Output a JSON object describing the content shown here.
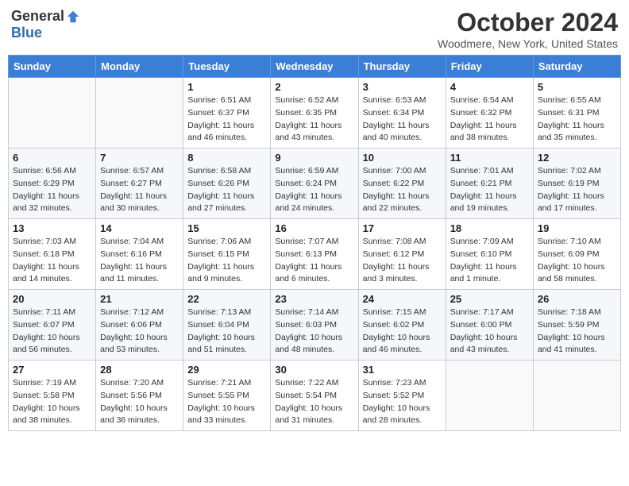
{
  "header": {
    "logo_general": "General",
    "logo_blue": "Blue",
    "month_title": "October 2024",
    "location": "Woodmere, New York, United States"
  },
  "days_of_week": [
    "Sunday",
    "Monday",
    "Tuesday",
    "Wednesday",
    "Thursday",
    "Friday",
    "Saturday"
  ],
  "weeks": [
    [
      {
        "day": "",
        "detail": ""
      },
      {
        "day": "",
        "detail": ""
      },
      {
        "day": "1",
        "detail": "Sunrise: 6:51 AM\nSunset: 6:37 PM\nDaylight: 11 hours and 46 minutes."
      },
      {
        "day": "2",
        "detail": "Sunrise: 6:52 AM\nSunset: 6:35 PM\nDaylight: 11 hours and 43 minutes."
      },
      {
        "day": "3",
        "detail": "Sunrise: 6:53 AM\nSunset: 6:34 PM\nDaylight: 11 hours and 40 minutes."
      },
      {
        "day": "4",
        "detail": "Sunrise: 6:54 AM\nSunset: 6:32 PM\nDaylight: 11 hours and 38 minutes."
      },
      {
        "day": "5",
        "detail": "Sunrise: 6:55 AM\nSunset: 6:31 PM\nDaylight: 11 hours and 35 minutes."
      }
    ],
    [
      {
        "day": "6",
        "detail": "Sunrise: 6:56 AM\nSunset: 6:29 PM\nDaylight: 11 hours and 32 minutes."
      },
      {
        "day": "7",
        "detail": "Sunrise: 6:57 AM\nSunset: 6:27 PM\nDaylight: 11 hours and 30 minutes."
      },
      {
        "day": "8",
        "detail": "Sunrise: 6:58 AM\nSunset: 6:26 PM\nDaylight: 11 hours and 27 minutes."
      },
      {
        "day": "9",
        "detail": "Sunrise: 6:59 AM\nSunset: 6:24 PM\nDaylight: 11 hours and 24 minutes."
      },
      {
        "day": "10",
        "detail": "Sunrise: 7:00 AM\nSunset: 6:22 PM\nDaylight: 11 hours and 22 minutes."
      },
      {
        "day": "11",
        "detail": "Sunrise: 7:01 AM\nSunset: 6:21 PM\nDaylight: 11 hours and 19 minutes."
      },
      {
        "day": "12",
        "detail": "Sunrise: 7:02 AM\nSunset: 6:19 PM\nDaylight: 11 hours and 17 minutes."
      }
    ],
    [
      {
        "day": "13",
        "detail": "Sunrise: 7:03 AM\nSunset: 6:18 PM\nDaylight: 11 hours and 14 minutes."
      },
      {
        "day": "14",
        "detail": "Sunrise: 7:04 AM\nSunset: 6:16 PM\nDaylight: 11 hours and 11 minutes."
      },
      {
        "day": "15",
        "detail": "Sunrise: 7:06 AM\nSunset: 6:15 PM\nDaylight: 11 hours and 9 minutes."
      },
      {
        "day": "16",
        "detail": "Sunrise: 7:07 AM\nSunset: 6:13 PM\nDaylight: 11 hours and 6 minutes."
      },
      {
        "day": "17",
        "detail": "Sunrise: 7:08 AM\nSunset: 6:12 PM\nDaylight: 11 hours and 3 minutes."
      },
      {
        "day": "18",
        "detail": "Sunrise: 7:09 AM\nSunset: 6:10 PM\nDaylight: 11 hours and 1 minute."
      },
      {
        "day": "19",
        "detail": "Sunrise: 7:10 AM\nSunset: 6:09 PM\nDaylight: 10 hours and 58 minutes."
      }
    ],
    [
      {
        "day": "20",
        "detail": "Sunrise: 7:11 AM\nSunset: 6:07 PM\nDaylight: 10 hours and 56 minutes."
      },
      {
        "day": "21",
        "detail": "Sunrise: 7:12 AM\nSunset: 6:06 PM\nDaylight: 10 hours and 53 minutes."
      },
      {
        "day": "22",
        "detail": "Sunrise: 7:13 AM\nSunset: 6:04 PM\nDaylight: 10 hours and 51 minutes."
      },
      {
        "day": "23",
        "detail": "Sunrise: 7:14 AM\nSunset: 6:03 PM\nDaylight: 10 hours and 48 minutes."
      },
      {
        "day": "24",
        "detail": "Sunrise: 7:15 AM\nSunset: 6:02 PM\nDaylight: 10 hours and 46 minutes."
      },
      {
        "day": "25",
        "detail": "Sunrise: 7:17 AM\nSunset: 6:00 PM\nDaylight: 10 hours and 43 minutes."
      },
      {
        "day": "26",
        "detail": "Sunrise: 7:18 AM\nSunset: 5:59 PM\nDaylight: 10 hours and 41 minutes."
      }
    ],
    [
      {
        "day": "27",
        "detail": "Sunrise: 7:19 AM\nSunset: 5:58 PM\nDaylight: 10 hours and 38 minutes."
      },
      {
        "day": "28",
        "detail": "Sunrise: 7:20 AM\nSunset: 5:56 PM\nDaylight: 10 hours and 36 minutes."
      },
      {
        "day": "29",
        "detail": "Sunrise: 7:21 AM\nSunset: 5:55 PM\nDaylight: 10 hours and 33 minutes."
      },
      {
        "day": "30",
        "detail": "Sunrise: 7:22 AM\nSunset: 5:54 PM\nDaylight: 10 hours and 31 minutes."
      },
      {
        "day": "31",
        "detail": "Sunrise: 7:23 AM\nSunset: 5:52 PM\nDaylight: 10 hours and 28 minutes."
      },
      {
        "day": "",
        "detail": ""
      },
      {
        "day": "",
        "detail": ""
      }
    ]
  ]
}
